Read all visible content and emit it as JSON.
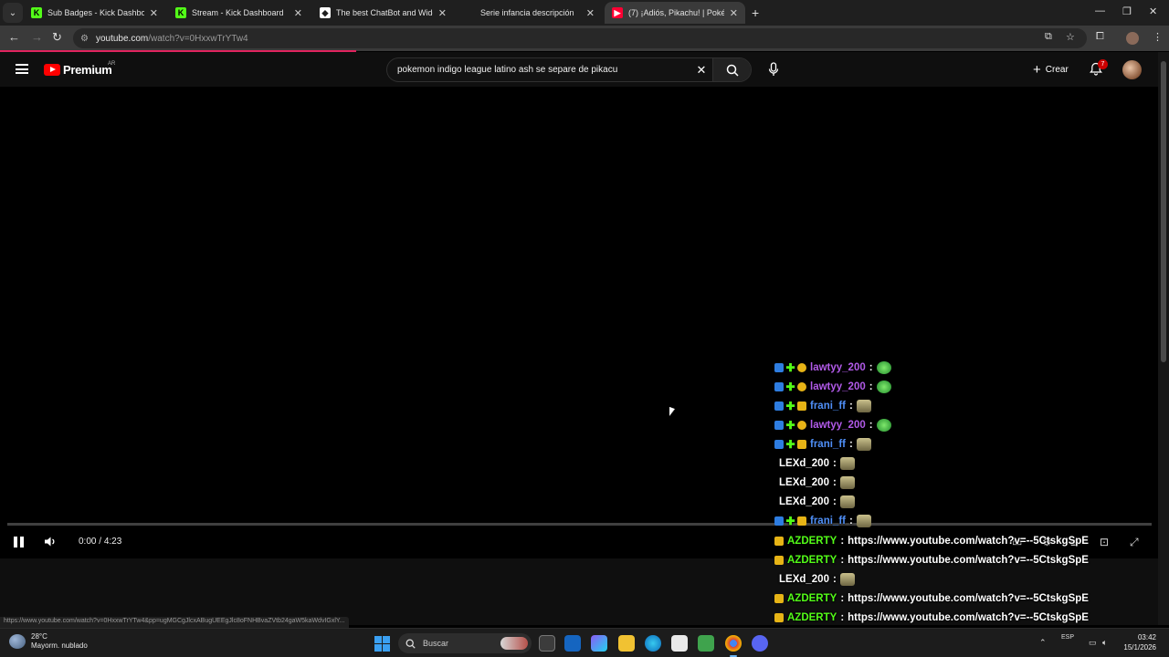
{
  "browser": {
    "tabs": [
      {
        "title": "Sub Badges - Kick Dashboard",
        "icon": "kick-icon",
        "active": false
      },
      {
        "title": "Stream - Kick Dashboard",
        "icon": "kick-icon",
        "active": false
      },
      {
        "title": "The best ChatBot and Widgets",
        "icon": "botrix-icon",
        "active": false
      },
      {
        "title": "Serie infancia descripción",
        "icon": "none",
        "active": false
      },
      {
        "title": "(7) ¡Adiós, Pikachu! | Pokémon",
        "icon": "youtube-icon",
        "active": true
      }
    ],
    "url_host": "youtube.com",
    "url_path": "/watch?v=0HxxwTrYTw4",
    "status_url": "https://www.youtube.com/watch?v=0HxxwTrYTw4&pp=ugMGCgJlcxABugUEEgJlc8oFNHBvaZVtb24gaW5kaWdvIGxlY..."
  },
  "youtube": {
    "brand": "Premium",
    "country": "AR",
    "search_query": "pokemon indigo league latino ash se separe de pikacu",
    "create_label": "Crear",
    "notification_count": "7",
    "colors": {
      "brand_red": "#ff0000",
      "badge": "#cc0000"
    }
  },
  "player": {
    "time_current": "0:00",
    "time_total": "4:23",
    "progress": 0
  },
  "chat": {
    "messages": [
      {
        "user": "frani_ff",
        "color": "#4f8ff7",
        "badges": [
          "mod",
          "plus",
          "sub"
        ],
        "content": "",
        "emote": "cat"
      },
      {
        "user": "lawtyy_200",
        "color": "#b15ae8",
        "badges": [
          "mod",
          "plus",
          "coin"
        ],
        "content": "",
        "emote": "goblin"
      },
      {
        "user": "lawtyy_200",
        "color": "#b15ae8",
        "badges": [
          "mod",
          "plus",
          "coin"
        ],
        "content": "",
        "emote": "goblin"
      },
      {
        "user": "frani_ff",
        "color": "#4f8ff7",
        "badges": [
          "mod",
          "plus",
          "sub"
        ],
        "content": "",
        "emote": "cat"
      },
      {
        "user": "lawtyy_200",
        "color": "#b15ae8",
        "badges": [
          "mod",
          "plus",
          "coin"
        ],
        "content": "",
        "emote": "goblin"
      },
      {
        "user": "frani_ff",
        "color": "#4f8ff7",
        "badges": [
          "mod",
          "plus",
          "sub"
        ],
        "content": "",
        "emote": "cat"
      },
      {
        "user": "LEXd_200",
        "color": "#ffffff",
        "badges": [],
        "content": "",
        "emote": "cat"
      },
      {
        "user": "LEXd_200",
        "color": "#ffffff",
        "badges": [],
        "content": "",
        "emote": "cat"
      },
      {
        "user": "LEXd_200",
        "color": "#ffffff",
        "badges": [],
        "content": "",
        "emote": "cat"
      },
      {
        "user": "frani_ff",
        "color": "#4f8ff7",
        "badges": [
          "mod",
          "plus",
          "sub"
        ],
        "content": "",
        "emote": "cat"
      },
      {
        "user": "AZDERTY",
        "color": "#53fc18",
        "badges": [
          "sub"
        ],
        "content": "https://www.youtube.com/watch?v=--5CtskgSpE",
        "emote": ""
      },
      {
        "user": "AZDERTY",
        "color": "#53fc18",
        "badges": [
          "sub"
        ],
        "content": "https://www.youtube.com/watch?v=--5CtskgSpE",
        "emote": ""
      },
      {
        "user": "LEXd_200",
        "color": "#ffffff",
        "badges": [],
        "content": "",
        "emote": "cat"
      },
      {
        "user": "AZDERTY",
        "color": "#53fc18",
        "badges": [
          "sub"
        ],
        "content": "https://www.youtube.com/watch?v=--5CtskgSpE",
        "emote": ""
      },
      {
        "user": "AZDERTY",
        "color": "#53fc18",
        "badges": [
          "sub"
        ],
        "content": "https://www.youtube.com/watch?v=--5CtskgSpE",
        "emote": ""
      },
      {
        "user": "AZDERTY",
        "color": "#53fc18",
        "badges": [
          "sub"
        ],
        "content": "https://www.youtube.com/watch?v=--5CtskgSpE",
        "emote": ""
      }
    ]
  },
  "taskbar": {
    "temperature": "28°C",
    "weather": "Mayorm. nublado",
    "weather_alert": "4",
    "search_label": "Buscar",
    "language": "ESP",
    "time": "03:42",
    "date": "15/1/2026"
  }
}
